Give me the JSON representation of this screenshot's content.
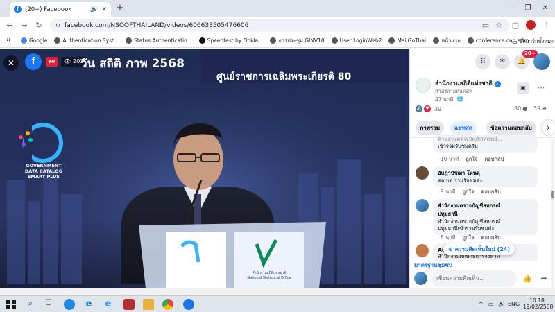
{
  "browser": {
    "tab_title": "(20+) Facebook",
    "url": "facebook.com/NSOOFTHAILAND/videos/606638505476606",
    "bookmarks": [
      {
        "label": "Google"
      },
      {
        "label": "Authentication Syst..."
      },
      {
        "label": "Status Authenticatio..."
      },
      {
        "label": "Speedtest by Ookla..."
      },
      {
        "label": "การประชุม GINV10"
      },
      {
        "label": "User LoginWeb2"
      },
      {
        "label": "MailGoThai"
      },
      {
        "label": "หน้าแรก"
      },
      {
        "label": "conference cad adm..."
      }
    ],
    "all_bookmarks_label": "บุ๊กมาร์กทั้งหมด"
  },
  "video": {
    "live_label": "สด",
    "viewer_count": "203",
    "banner_top": "วัน สถิติ ภาพ 2568",
    "banner_sub": "ศูนย์ราชการเฉลิมพระเกียรติ 80",
    "logo_line1": "GOVERNMENT",
    "logo_line2": "DATA CATALOG",
    "logo_line3": "SMART PLUS",
    "podium_text1": "National Statistical Office",
    "podium_text_th": "สำนักงานสถิติแห่งชาติ"
  },
  "header": {
    "notification_badge": "20+"
  },
  "post": {
    "page_name": "สำนักงานสถิติแห่งชาติ",
    "status": "กำลังถ่ายทอดสด",
    "time": "47 นาที",
    "reactions_count": "39",
    "comments_count": "80",
    "shares_count": "39"
  },
  "tabs": [
    {
      "label": "ภาพรวม"
    },
    {
      "label": "แชทสด"
    },
    {
      "label": "ข้อความตอบกลับ"
    }
  ],
  "comments": [
    {
      "name": "",
      "text": "ด้านงานตรวจบัญชีสหกรณ์...",
      "text2": "เข้าร่วมรับชมครับ",
      "time": "10 นาที",
      "like": "ถูกใจ",
      "reply": "ตอบกลับ"
    },
    {
      "name": "อัษฎาปัชฌา โหนดุ",
      "text": "ศอ.บต.ร่วมรับชมค่ะ",
      "text2": "",
      "time": "9 นาที",
      "like": "ถูกใจ",
      "reply": "ตอบกลับ"
    },
    {
      "name": "สำนักงานตรวจบัญชีสหกรณ์",
      "name2": "ปทุมธานี",
      "text": "สำนักงานตรวจบัญชีสหกรณ์",
      "text2": "ปทุมธานีเข้าร่วมรับชมค่ะ",
      "time": "8 นาที",
      "like": "ถูกใจ",
      "reply": "ตอบกลับ"
    },
    {
      "name": "Aur",
      "text": "สำนักงานศึกษาธิการจังหวัด",
      "text2": "",
      "time": "",
      "like": "",
      "reply": ""
    }
  ],
  "new_comments_label": "ความคิดเห็นใหม่ (24)",
  "partial_comment": "มาตรฐานชุมชน",
  "comment_placeholder": "เขียนความคิดเห็น...",
  "taskbar": {
    "lang": "ENG",
    "time": "10:18",
    "date": "19/02/2568"
  },
  "colors": {
    "facebook_blue": "#1877f2",
    "live_red": "#e41e3f",
    "accent": "#0866ff"
  }
}
